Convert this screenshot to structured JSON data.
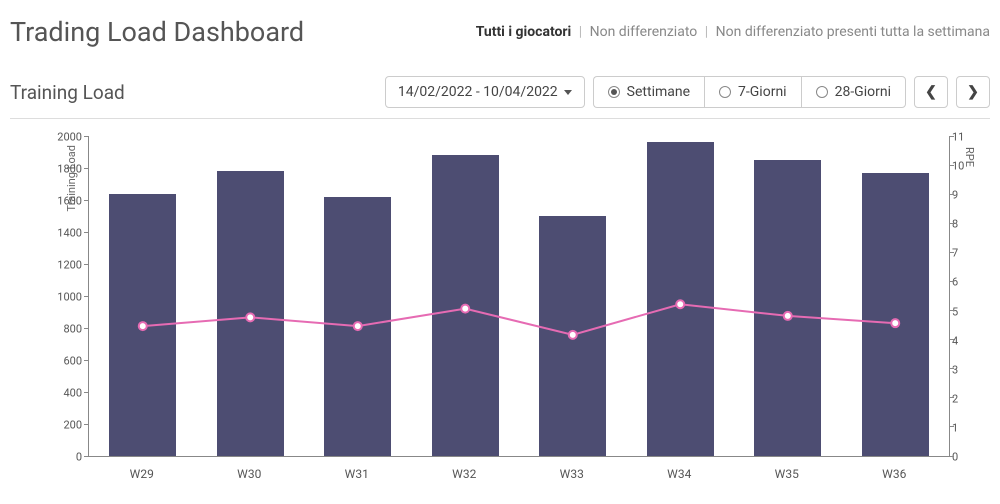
{
  "header": {
    "title": "Trading Load Dashboard",
    "tabs": {
      "active": "Tutti i giocatori",
      "second": "Non differenziato",
      "third": "Non differenziato presenti tutta la settimana"
    }
  },
  "sub": {
    "title": "Training Load"
  },
  "controls": {
    "date_range": "14/02/2022 - 10/04/2022",
    "periods": {
      "settimane": "Settimane",
      "sette": "7-Giorni",
      "ventotto": "28-Giorni"
    },
    "selected_period": "settimane"
  },
  "chart_data": {
    "type": "bar+line",
    "categories": [
      "W29",
      "W30",
      "W31",
      "W32",
      "W33",
      "W34",
      "W35",
      "W36"
    ],
    "series": [
      {
        "name": "Training Load",
        "axis": "y1",
        "type": "bar",
        "values": [
          1640,
          1780,
          1620,
          1880,
          1500,
          1960,
          1850,
          1770
        ]
      },
      {
        "name": "RPE",
        "axis": "y2",
        "type": "line",
        "values": [
          4.5,
          4.8,
          4.5,
          5.1,
          4.2,
          5.25,
          4.85,
          4.6
        ]
      }
    ],
    "y1": {
      "label": "Training Load",
      "min": 0,
      "max": 2000,
      "step": 200
    },
    "y2": {
      "label": "RPE",
      "min": 0,
      "max": 11,
      "step": 1
    },
    "colors": {
      "bar": "#4d4d72",
      "line": "#e66bb3"
    }
  }
}
